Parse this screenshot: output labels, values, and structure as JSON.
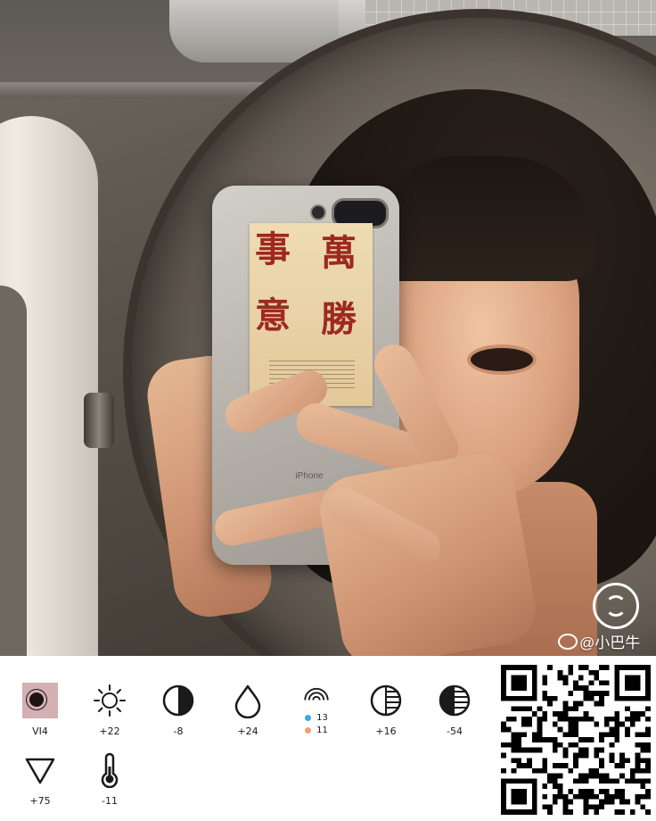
{
  "watermark": {
    "text": "@小巴牛"
  },
  "phone": {
    "brand": "iPhone",
    "sticker_chars": [
      "萬",
      "事",
      "勝",
      "意"
    ]
  },
  "tools": [
    {
      "name": "preset",
      "icon": "preset-thumbnail",
      "value": "VI4"
    },
    {
      "name": "exposure",
      "icon": "sun-icon",
      "value": "+22"
    },
    {
      "name": "contrast",
      "icon": "contrast-icon",
      "value": "-8"
    },
    {
      "name": "saturation",
      "icon": "droplet-icon",
      "value": "+24"
    },
    {
      "name": "hsl",
      "icon": "rainbow-icon",
      "values": [
        {
          "color": "#3aa8e0",
          "value": "13"
        },
        {
          "color": "#f0a06a",
          "value": "11"
        }
      ]
    },
    {
      "name": "highlights",
      "icon": "highlights-icon",
      "value": "+16"
    },
    {
      "name": "shadows",
      "icon": "shadows-icon",
      "value": "-54"
    },
    {
      "name": "fade",
      "icon": "triangle-down-icon",
      "value": "+75"
    },
    {
      "name": "temperature",
      "icon": "thermometer-icon",
      "value": "-11"
    }
  ],
  "colors": {
    "panel_bg": "#ffffff",
    "icon_stroke": "#1a1a1a",
    "preset_bg": "#d4b0b3",
    "sticker_ink": "#9c2a20"
  }
}
